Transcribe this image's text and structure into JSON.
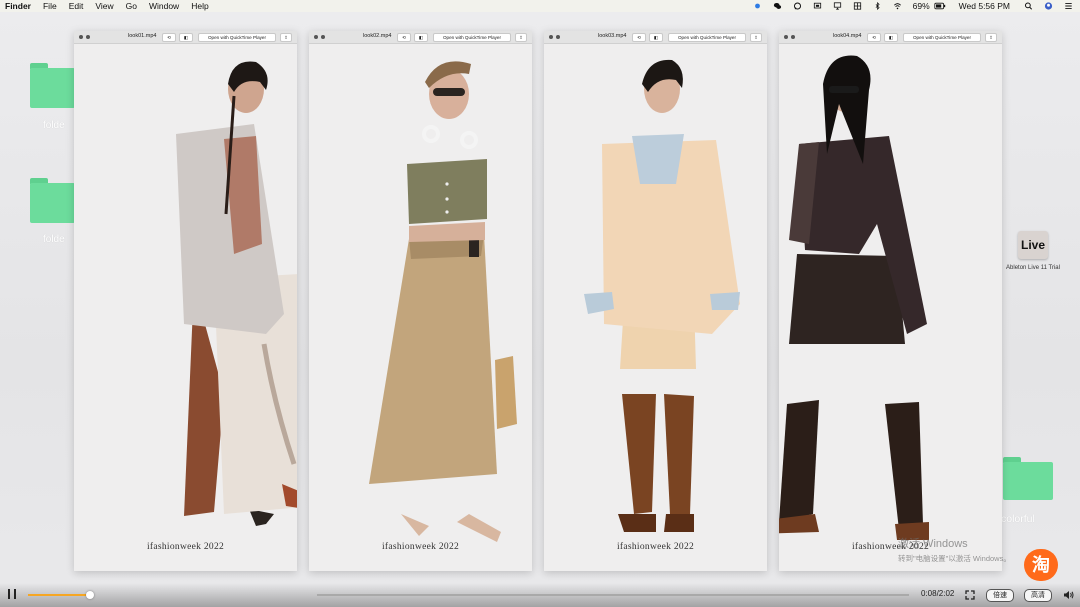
{
  "menubar": {
    "app": "Finder",
    "items": [
      "File",
      "Edit",
      "View",
      "Go",
      "Window",
      "Help"
    ],
    "battery": "69%",
    "clock": "Wed 5:56 PM",
    "icons": [
      "status-dot-icon",
      "wechat-icon",
      "chat-icon",
      "screen-share-icon",
      "airplay-icon",
      "grid-app-icon",
      "bluetooth-icon",
      "wifi-icon",
      "battery-icon",
      "search-icon",
      "user-avatar-icon",
      "control-center-icon"
    ]
  },
  "desktop": {
    "folders_left": [
      {
        "label": "folde"
      },
      {
        "label": "folde"
      }
    ],
    "app_icon": {
      "glyph": "Live",
      "label": "Ableton Live 11 Trial"
    },
    "folder_right": {
      "label": "colorful"
    },
    "folder_color": "#6cdc9c"
  },
  "windows": [
    {
      "filename": "look01.mp4",
      "open_button": "Open with QuickTime Player",
      "caption": "ifashionweek 2022",
      "outfit": "light-jacket-printed-skirt"
    },
    {
      "filename": "look02.mp4",
      "open_button": "Open with QuickTime Player",
      "caption": "ifashionweek 2022",
      "outfit": "knit-crop-vest-khaki-skirt"
    },
    {
      "filename": "look03.mp4",
      "open_button": "Open with QuickTime Player",
      "caption": "ifashionweek 2022",
      "outfit": "cream-suit-brown-boots"
    },
    {
      "filename": "look04.mp4",
      "open_button": "Open with QuickTime Player",
      "caption": "ifashionweek 2022",
      "outfit": "black-leather-cutout-dress"
    }
  ],
  "watermark": {
    "line1": "激活 Windows",
    "line2": "转到\"电脑设置\"以激活 Windows。"
  },
  "taobao_logo": "淘",
  "player": {
    "time": "0:08/2:02",
    "progress_fraction": 0.066,
    "speed_label": "倍速",
    "quality_label": "高清",
    "accent": "#f6a623"
  }
}
